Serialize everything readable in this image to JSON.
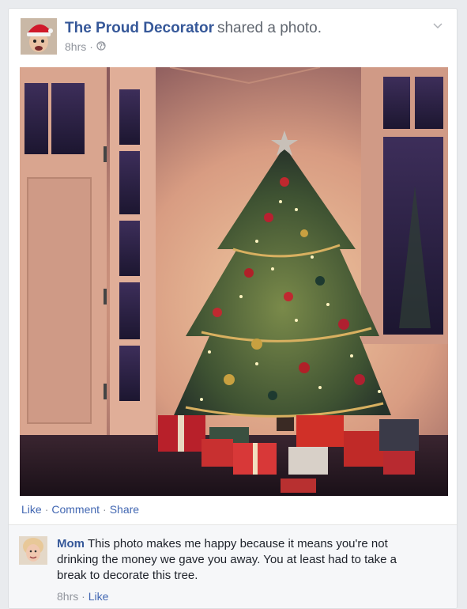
{
  "post": {
    "author": "The Proud Decorator",
    "action": "shared a photo.",
    "time": "8hrs",
    "separator": "·",
    "audience_icon": "globe-icon",
    "options_icon": "chevron-down-icon"
  },
  "actions": {
    "like": "Like",
    "comment": "Comment",
    "share": "Share",
    "separator": "·"
  },
  "comment": {
    "author": "Mom",
    "text": "This photo makes me happy because it means you're not drinking the money we gave you away. You at least had to take a break to decorate this tree.",
    "time": "8hrs",
    "separator": "·",
    "like": "Like"
  },
  "colors": {
    "link_blue": "#365899",
    "action_blue": "#4267b2",
    "meta_gray": "#90949c",
    "card_bg": "#ffffff",
    "page_bg": "#e9ebee"
  }
}
